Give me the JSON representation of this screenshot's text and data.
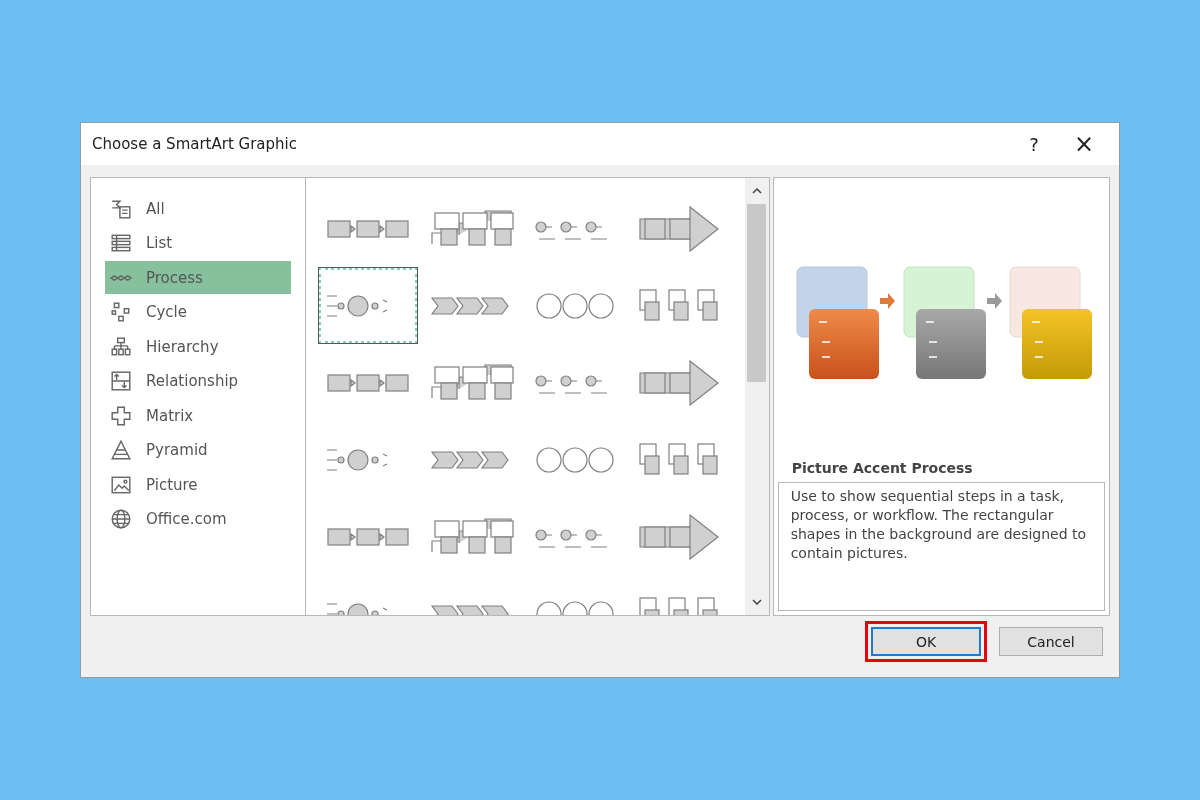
{
  "dialog": {
    "title": "Choose a SmartArt Graphic",
    "help": "?",
    "close": "×"
  },
  "categories": [
    {
      "label": "All",
      "selected": false
    },
    {
      "label": "List",
      "selected": false
    },
    {
      "label": "Process",
      "selected": true
    },
    {
      "label": "Cycle",
      "selected": false
    },
    {
      "label": "Hierarchy",
      "selected": false
    },
    {
      "label": "Relationship",
      "selected": false
    },
    {
      "label": "Matrix",
      "selected": false
    },
    {
      "label": "Pyramid",
      "selected": false
    },
    {
      "label": "Picture",
      "selected": false
    },
    {
      "label": "Office.com",
      "selected": false
    }
  ],
  "layouts": [
    {
      "selected": false
    },
    {
      "selected": false
    },
    {
      "selected": false
    },
    {
      "selected": false
    },
    {
      "selected": true
    },
    {
      "selected": false
    },
    {
      "selected": false
    },
    {
      "selected": false
    },
    {
      "selected": false
    },
    {
      "selected": false
    },
    {
      "selected": false
    },
    {
      "selected": false
    },
    {
      "selected": false
    },
    {
      "selected": false
    },
    {
      "selected": false
    },
    {
      "selected": false
    },
    {
      "selected": false
    },
    {
      "selected": false
    },
    {
      "selected": false
    },
    {
      "selected": false
    },
    {
      "selected": false
    },
    {
      "selected": false
    },
    {
      "selected": false
    },
    {
      "selected": false
    }
  ],
  "preview": {
    "title": "Picture Accent Process",
    "description": "Use to show sequential steps in a task, process, or workflow. The rectangular shapes in the background are designed to contain pictures."
  },
  "buttons": [
    {
      "label": "OK",
      "default": true,
      "highlighted": true
    },
    {
      "label": "Cancel",
      "default": false,
      "highlighted": false
    }
  ]
}
